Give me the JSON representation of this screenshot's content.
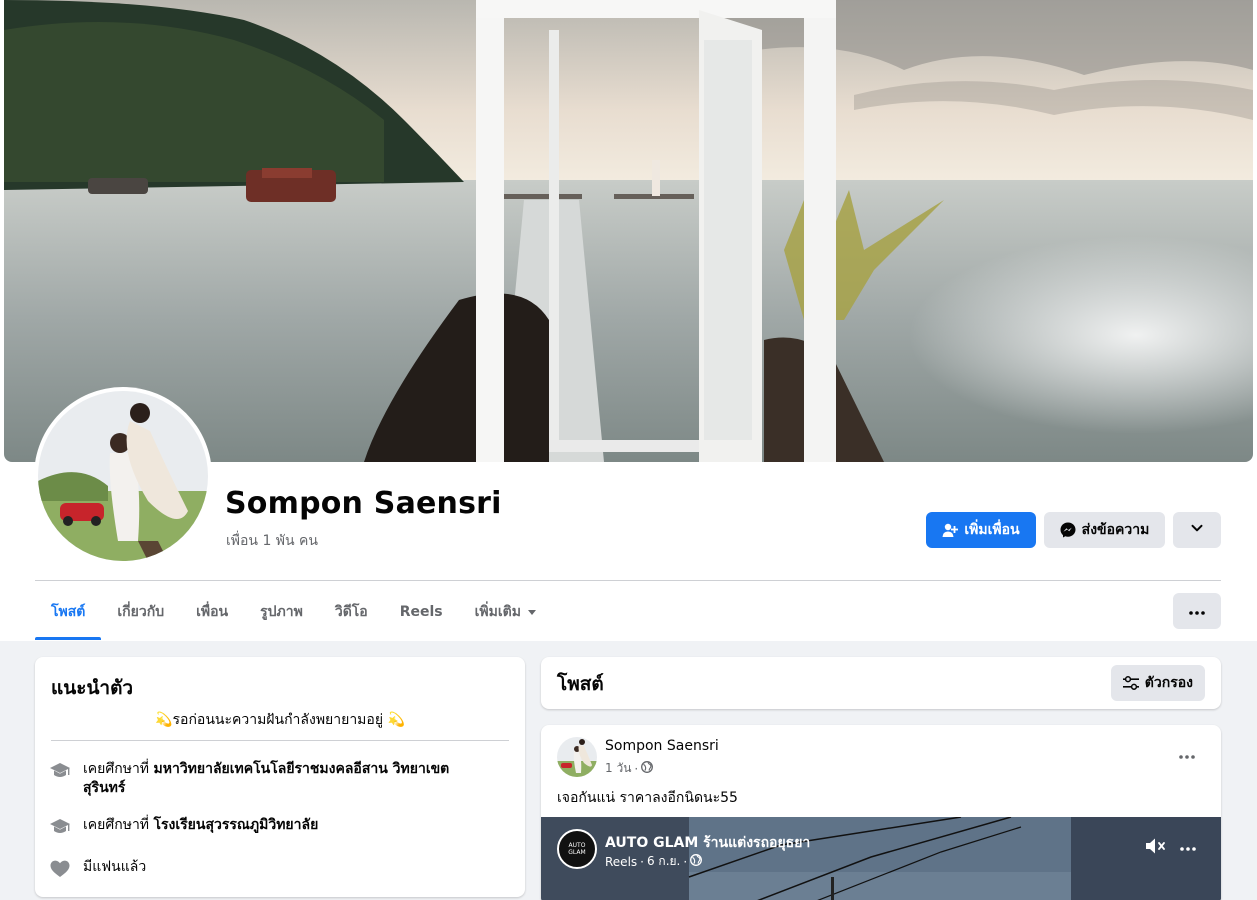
{
  "profile": {
    "name": "Sompon Saensri",
    "friends": "เพื่อน 1 พัน คน",
    "add_friend": "เพิ่มเพื่อน",
    "message": "ส่งข้อความ"
  },
  "tabs": [
    {
      "label": "โพสต์",
      "active": true
    },
    {
      "label": "เกี่ยวกับ"
    },
    {
      "label": "เพื่อน"
    },
    {
      "label": "รูปภาพ"
    },
    {
      "label": "วิดีโอ"
    },
    {
      "label": "Reels"
    },
    {
      "label": "เพิ่มเติม"
    }
  ],
  "intro": {
    "title": "แนะนำตัว",
    "bio": "💫รอก่อนนะความฝันกำลังพยายามอยู่ 💫",
    "items": [
      {
        "prefix": "เคยศึกษาที่ ",
        "bold": "มหาวิทยาลัยเทคโนโลยีราชมงคลอีสาน วิทยาเขต",
        "bold2": "สุรินทร์",
        "icon": "graduation-cap-icon"
      },
      {
        "prefix": "เคยศึกษาที่ ",
        "bold": "โรงเรียนสุวรรณภูมิวิทยาลัย",
        "icon": "graduation-cap-icon"
      },
      {
        "prefix": "มีแฟนแล้ว",
        "icon": "heart-icon"
      }
    ]
  },
  "posts": {
    "title": "โพสต์",
    "filter": "ตัวกรอง"
  },
  "post": {
    "author": "Sompon Saensri",
    "time": "1 วัน",
    "text": "เจอกันแน่ ราคาลงอีกนิดนะ55",
    "reel": {
      "page_name": "AUTO GLAM ร้านแต่งรถอยุธยา",
      "source": "Reels",
      "date": "6 ก.ย.",
      "logo_text": "AUTO GLAM"
    }
  },
  "colors": {
    "accent": "#1877f2",
    "secondary_text": "#65676b",
    "button_gray": "#e4e6eb",
    "page_bg": "#f0f2f5"
  }
}
